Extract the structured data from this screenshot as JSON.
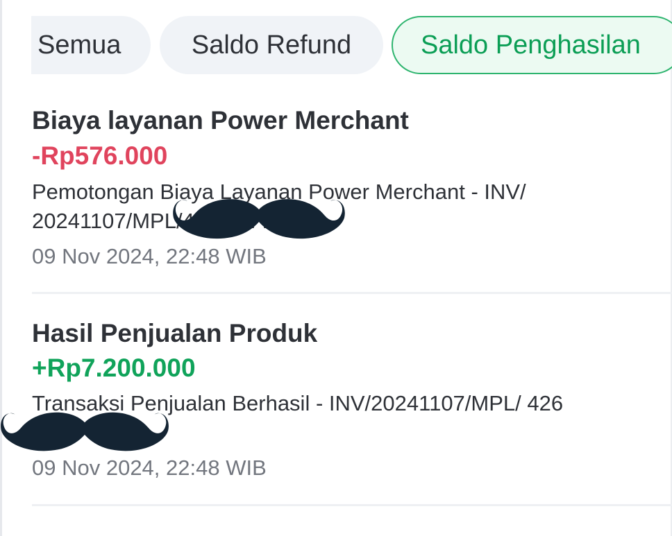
{
  "tabs": [
    {
      "label": "Semua",
      "active": false
    },
    {
      "label": "Saldo Refund",
      "active": false
    },
    {
      "label": "Saldo Penghasilan",
      "active": true
    }
  ],
  "transactions": [
    {
      "title": "Biaya layanan Power Merchant",
      "amount": "-Rp576.000",
      "description": "Pemotongan Biaya Layanan Power Merchant - INV/ 20241107/MPL/4269 4779",
      "datetime": "09 Nov 2024, 22:48 WIB"
    },
    {
      "title": "Hasil Penjualan Produk",
      "amount": "+Rp7.200.000",
      "description": "Transaksi Penjualan Berhasil - INV/20241107/MPL/ 426 4779",
      "datetime": "09 Nov 2024, 22:48 WIB"
    }
  ],
  "colors": {
    "accent_green": "#0b9e55",
    "negative_red": "#e0445d",
    "chip_background": "#f0f3f7"
  }
}
